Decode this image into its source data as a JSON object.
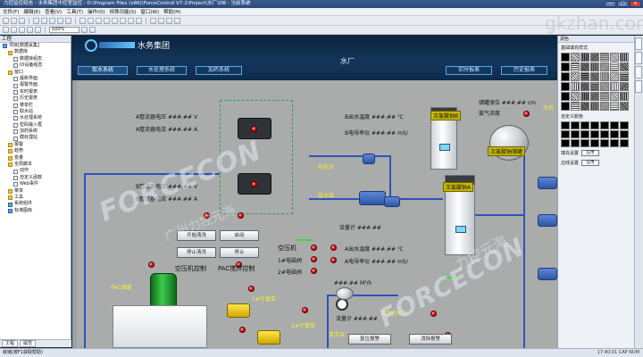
{
  "window": {
    "title": "力控监控组态 - 水务集团中控室监控 - D:\\Program Files (x86)\\ForceControl V7.2\\Project\\水厂\\DB - 当前系统",
    "min": "—",
    "max": "□",
    "close": "×"
  },
  "menu": [
    "文件(F)",
    "编辑(E)",
    "查看(V)",
    "工具(T)",
    "操作(O)",
    "特殊功能(S)",
    "窗口(W)",
    "帮助(H)"
  ],
  "toolbar": {
    "zoom": "100%"
  },
  "left_panel": {
    "title": "工程",
    "items": [
      {
        "label": "项目[数据采集]",
        "depth": 0,
        "icon": "blue"
      },
      {
        "label": "数据库",
        "depth": 1,
        "icon": "folder"
      },
      {
        "label": "数据库组态",
        "depth": 2,
        "icon": "page"
      },
      {
        "label": "IO设备组态",
        "depth": 2,
        "icon": "page"
      },
      {
        "label": "窗口",
        "depth": 1,
        "icon": "folder"
      },
      {
        "label": "最新界面",
        "depth": 2,
        "icon": "page"
      },
      {
        "label": "报警界面",
        "depth": 2,
        "icon": "page"
      },
      {
        "label": "实时报表",
        "depth": 2,
        "icon": "page"
      },
      {
        "label": "历史报表",
        "depth": 2,
        "icon": "page"
      },
      {
        "label": "菜单栏",
        "depth": 2,
        "icon": "page"
      },
      {
        "label": "取水站",
        "depth": 2,
        "icon": "page"
      },
      {
        "label": "水处理系统",
        "depth": 2,
        "icon": "page"
      },
      {
        "label": "密码输入框",
        "depth": 2,
        "icon": "page"
      },
      {
        "label": "加药系统",
        "depth": 2,
        "icon": "page"
      },
      {
        "label": "膜处理站",
        "depth": 2,
        "icon": "page"
      },
      {
        "label": "报警",
        "depth": 1,
        "icon": "folder"
      },
      {
        "label": "趋势",
        "depth": 1,
        "icon": "folder"
      },
      {
        "label": "变量",
        "depth": 1,
        "icon": "folder"
      },
      {
        "label": "全局脚本",
        "depth": 1,
        "icon": "folder"
      },
      {
        "label": "动作",
        "depth": 2,
        "icon": "page"
      },
      {
        "label": "自定义函数",
        "depth": 2,
        "icon": "page"
      },
      {
        "label": "Web事件",
        "depth": 2,
        "icon": "page"
      },
      {
        "label": "菜单",
        "depth": 1,
        "icon": "folder"
      },
      {
        "label": "工具",
        "depth": 1,
        "icon": "folder"
      },
      {
        "label": "系统组件",
        "depth": 1,
        "icon": "blue"
      },
      {
        "label": "标准图库",
        "depth": 1,
        "icon": "blue"
      }
    ],
    "tabs": [
      "工程",
      "属性"
    ]
  },
  "status": {
    "left": "就绪(按F1获取帮助)",
    "right": "17:40:01   CAP   NUM"
  },
  "right_panel": {
    "title": "调色",
    "fill_style_label": "基础填充样式",
    "custom_colors_label": "自定义颜色",
    "fill_setting_label": "填充设置",
    "border_setting_label": "边线设置",
    "apply_label": "应用"
  },
  "hmi": {
    "company": "水务集团",
    "plant": "水厂",
    "tabs": [
      {
        "label": "取水系统",
        "active": true
      },
      {
        "label": "水处理系统",
        "active": false
      },
      {
        "label": "加药系统",
        "active": false
      },
      {
        "label": "实时报表",
        "active": false
      },
      {
        "label": "历史报表",
        "active": false
      }
    ],
    "rectifier": {
      "a_voltage": "A整流器电压  ###.## V",
      "a_current": "A整流器电流  ###.## A",
      "b_voltage": "B整流器电压  ###.## V",
      "b_current": "B整流器电流  ###.## A"
    },
    "buttons": {
      "start_clean": "开始清洗",
      "start": "启动",
      "stop_clean": "停止清洗",
      "stop": "停止"
    },
    "compressor": {
      "label": "空压机控制",
      "items": [
        "空压机",
        "1#电磁阀",
        "2#电磁阀"
      ]
    },
    "pac_label": "PAC搅拌控制",
    "pac_tank": "PAC储罐",
    "flow_unit": "###.##   M³/h",
    "b_outlet_temp": "B出水温度  ###.## ℃",
    "b_conductivity": "B电导率仪  ###.## mS/",
    "a_outlet_temp": "A出水温度  ###.## ℃",
    "a_conductivity": "A电导率仪  ###.## mS/",
    "level": "储罐液位  ###.## cm",
    "chlorine": "氯气浓度",
    "gen_a": "次氯酸钠A",
    "gen_b": "次氯酸钠B",
    "gen_tank": "次氯酸钠储罐",
    "softened_water": "软化水",
    "salt_water": "盐水泵",
    "flow_reading": "流量计  ###.##",
    "metering1": "1#计量泵",
    "metering2": "2#计量泵",
    "clean_water": "清洗进水口",
    "clean_pump": "清洗泵",
    "btn_reset": "复位报警",
    "btn_mute": "消除报警",
    "wind_label": "风机",
    "watermark_en": "FORCECON",
    "watermark_cn": "广州力控元海",
    "watermark_cn2": "力控元海",
    "site": "gkzhan.com"
  }
}
